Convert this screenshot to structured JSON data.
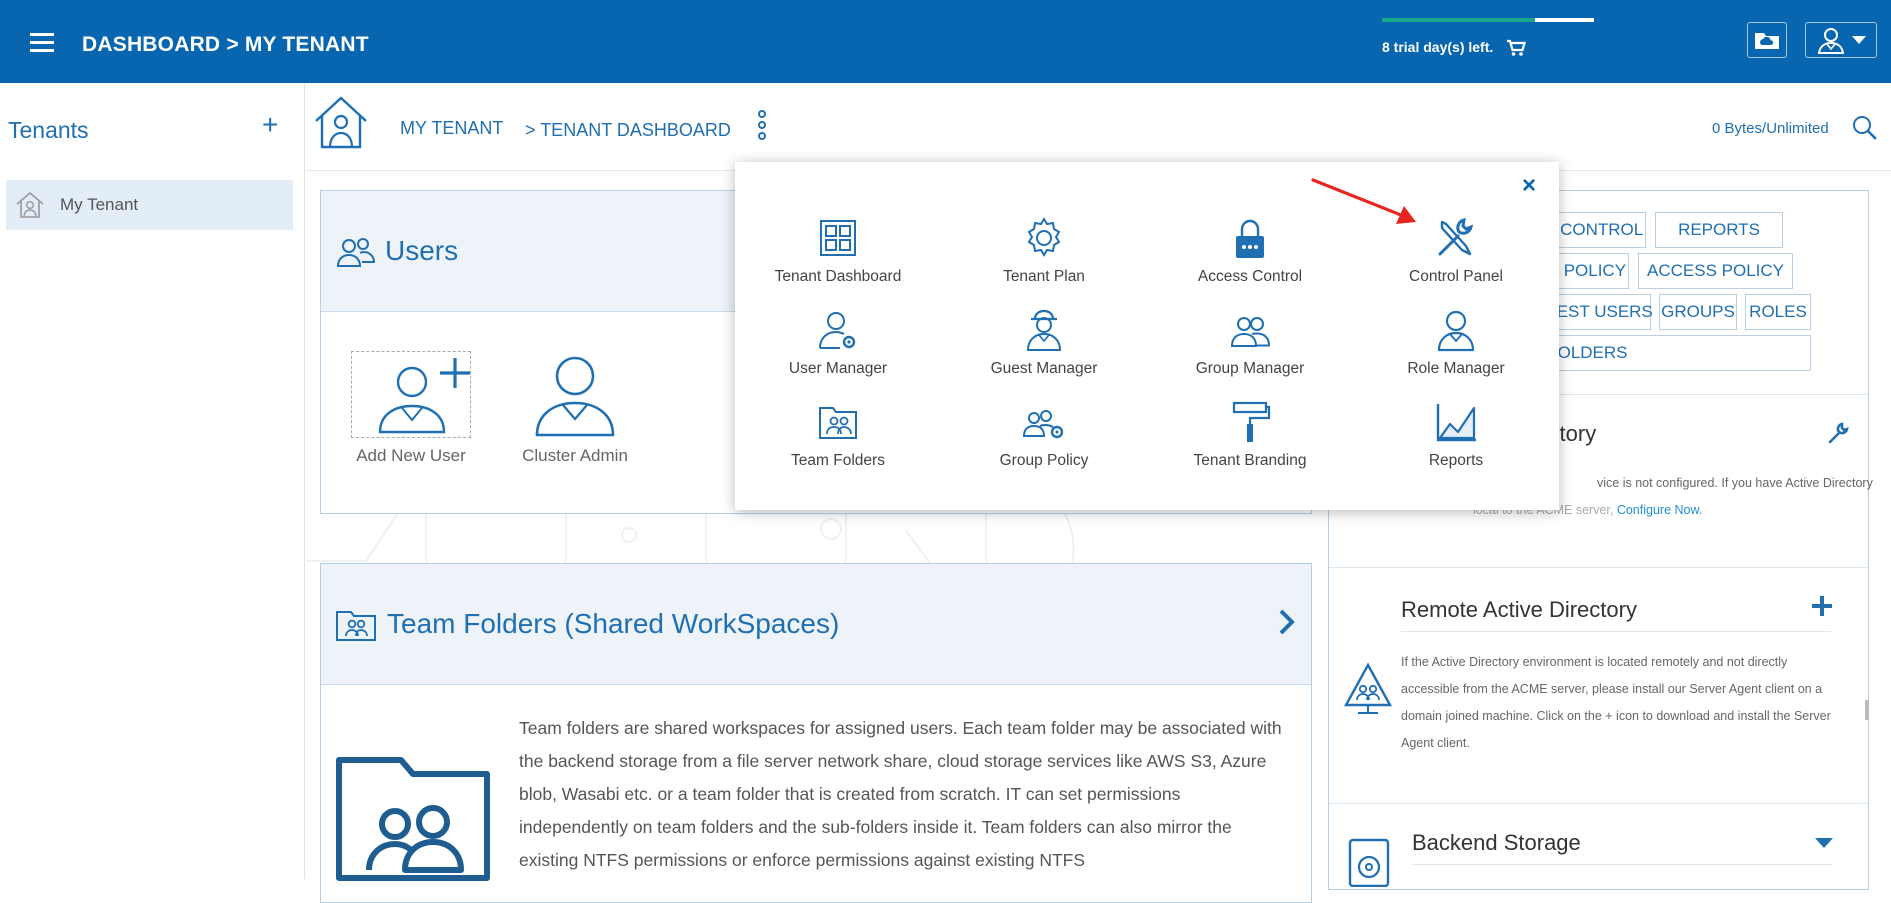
{
  "topbar": {
    "title": "DASHBOARD > MY TENANT",
    "trial_text": "8 trial day(s) left.",
    "trial_remaining_fraction": 0.72,
    "icons": [
      "menu-icon",
      "cart-icon",
      "cloud-folder-icon",
      "user-icon",
      "caret-down-icon"
    ],
    "colors": {
      "bar": "#0866b0",
      "trial_progress": "#17a88a"
    }
  },
  "sidebar": {
    "title": "Tenants",
    "add_symbol": "+",
    "items": [
      {
        "label": "My Tenant",
        "icon": "home-icon",
        "selected": true
      }
    ]
  },
  "header": {
    "breadcrumb": [
      "MY TENANT",
      "> TENANT DASHBOARD"
    ],
    "storage": "0 Bytes/Unlimited",
    "icons": [
      "home-icon",
      "more-vertical-icon",
      "search-icon"
    ]
  },
  "users_card": {
    "title": "Users",
    "tiles": [
      {
        "label": "Add New User",
        "icon": "add-user-icon"
      },
      {
        "label": "Cluster Admin",
        "icon": "user-icon"
      }
    ]
  },
  "team_folders_card": {
    "title": "Team Folders (Shared WorkSpaces)",
    "description": "Team folders are shared workspaces for assigned users. Each team folder may be associated with the backend storage from a file server network share, cloud storage services like AWS S3, Azure blob, Wasabi etc. or a team folder that is created from scratch. IT can set permissions independently on team folders and the sub-folders inside it. Team folders can also mirror the existing NTFS permissions or enforce permissions against existing NTFS"
  },
  "right_panel": {
    "tabs_row1": [
      "CCESS CONTROL",
      "REPORTS"
    ],
    "tabs_row2": [
      "GROUP POLICY",
      "ACCESS POLICY"
    ],
    "tabs_row3": [
      "GUEST USERS",
      "GROUPS",
      "ROLES"
    ],
    "tabs_row4": [
      "AM FOLDERS"
    ],
    "active_directory": {
      "title": "rectory",
      "text_line1": "vice is not configured. If you have Active Directory",
      "text_line2_prefix": "local to the ACME server,",
      "link": "Configure Now."
    },
    "remote_ad": {
      "title": "Remote Active Directory",
      "text": "If the Active Directory environment is located remotely and not directly accessible from the ACME server, please install our Server Agent client on a domain joined machine. Click on the + icon to download and install the Server Agent client."
    },
    "backend_storage": {
      "title": "Backend Storage"
    }
  },
  "popup_menu": {
    "close_symbol": "×",
    "items": [
      {
        "label": "Tenant Dashboard",
        "icon": "dashboard-grid-icon"
      },
      {
        "label": "Tenant Plan",
        "icon": "gear-icon"
      },
      {
        "label": "Access Control",
        "icon": "lock-icon"
      },
      {
        "label": "Control Panel",
        "icon": "tools-icon"
      },
      {
        "label": "User Manager",
        "icon": "user-gear-icon"
      },
      {
        "label": "Guest Manager",
        "icon": "guest-user-icon"
      },
      {
        "label": "Group Manager",
        "icon": "group-icon"
      },
      {
        "label": "Role Manager",
        "icon": "role-user-icon"
      },
      {
        "label": "Team Folders",
        "icon": "team-folder-icon"
      },
      {
        "label": "Group Policy",
        "icon": "group-policy-icon"
      },
      {
        "label": "Tenant Branding",
        "icon": "paint-roller-icon"
      },
      {
        "label": "Reports",
        "icon": "chart-icon"
      }
    ]
  },
  "annotation": {
    "color": "#e8251f",
    "target": "Control Panel"
  }
}
